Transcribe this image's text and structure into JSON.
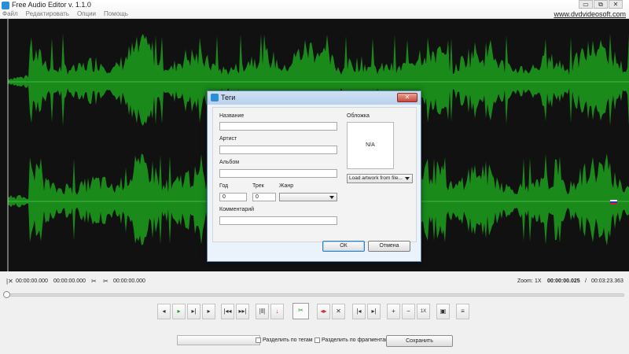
{
  "app": {
    "title": "Free Audio Editor v. 1.1.0",
    "menu": [
      "Файл",
      "Редактировать",
      "Опции",
      "Помощь"
    ],
    "site": "www.dvdvideosoft.com",
    "win_controls": [
      "▭",
      "⧉",
      "✕"
    ]
  },
  "colors": {
    "waveform": "#1a8a1a",
    "waveform_bg": "#111111",
    "accent": "#2b8fd6"
  },
  "dialog": {
    "title": "Теги",
    "close_label": "✕",
    "fields": {
      "name_label": "Название",
      "name_value": "",
      "artist_label": "Артист",
      "artist_value": "",
      "album_label": "Альбом",
      "album_value": "",
      "year_label": "Год",
      "year_value": "0",
      "track_label": "Трек",
      "track_value": "0",
      "genre_label": "Жанр",
      "genre_value": "",
      "comment_label": "Комментарий",
      "comment_value": ""
    },
    "cover": {
      "label": "Обложка",
      "placeholder": "N/A",
      "load_button": "Load artwork from file..."
    },
    "ok_label": "ОК",
    "cancel_label": "Отмена"
  },
  "timeline": {
    "sel_start": "00:00:00.000",
    "sel_end": "00:00:00.000",
    "cursor": "00:00:00.000",
    "zoom_label": "Zoom:",
    "zoom_value": "1X",
    "position": "00:00:00.025",
    "separator": "/",
    "duration": "00:03:23.363"
  },
  "toolbar": {
    "buttons": [
      {
        "name": "rewind-button",
        "icon": "◂"
      },
      {
        "name": "play-button",
        "icon": "▸"
      },
      {
        "name": "play-to-end-button",
        "icon": "▸|"
      },
      {
        "name": "forward-button",
        "icon": "▸"
      },
      {
        "name": "go-start-button",
        "icon": "|◂◂"
      },
      {
        "name": "go-end-button",
        "icon": "▸▸|"
      },
      {
        "name": "split-marker-button",
        "icon": "|‖|"
      },
      {
        "name": "download-button",
        "icon": "↓"
      },
      {
        "name": "cut-button",
        "icon": "✂"
      },
      {
        "name": "insert-button",
        "icon": "◂▸"
      },
      {
        "name": "delete-button",
        "icon": "✕"
      },
      {
        "name": "sel-start-button",
        "icon": "|◂"
      },
      {
        "name": "sel-end-button",
        "icon": "▸|"
      },
      {
        "name": "zoom-in-button",
        "icon": "+"
      },
      {
        "name": "zoom-out-button",
        "icon": "−"
      },
      {
        "name": "zoom-1x-button",
        "icon": "1X"
      },
      {
        "name": "image-button",
        "icon": "▣"
      },
      {
        "name": "settings-button",
        "icon": "≡"
      }
    ]
  },
  "bottom": {
    "split_by_tags": "Разделить по тегам",
    "split_by_fragments": "Разделить по фрагментам",
    "save_label": "Сохранить"
  }
}
